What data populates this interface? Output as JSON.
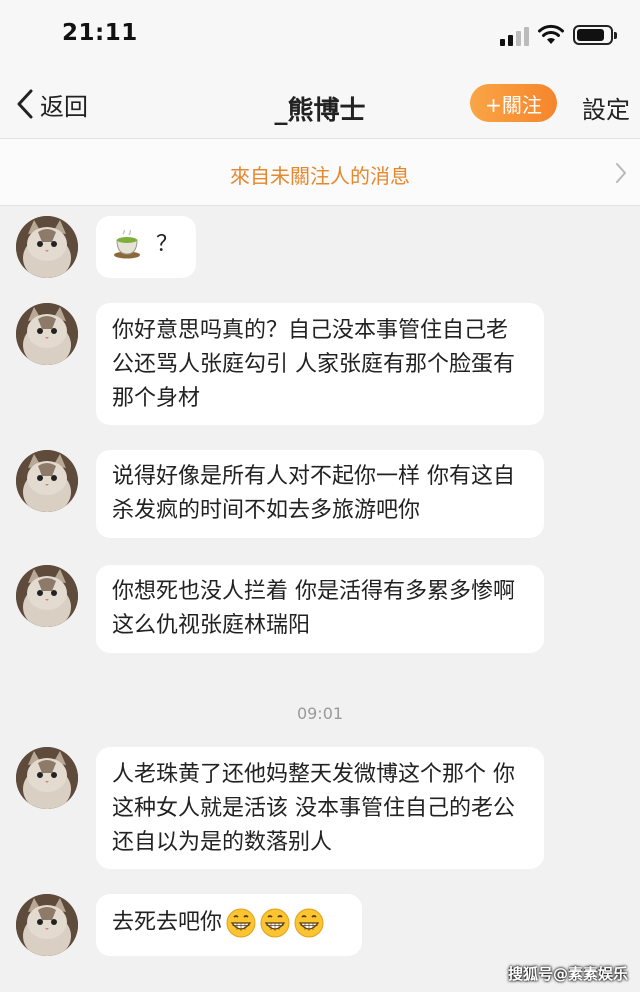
{
  "status_bar": {
    "time": "21:11"
  },
  "nav": {
    "back_label": "返回",
    "title": "_熊博士",
    "follow_label": "+關注",
    "settings_label": "設定"
  },
  "banner": {
    "text": "來自未關注人的消息"
  },
  "messages": [
    {
      "text": "？",
      "icon": "tea-icon"
    },
    {
      "text": "你好意思吗真的？自己没本事管住自己老公还骂人张庭勾引  人家张庭有那个脸蛋有那个身材"
    },
    {
      "text": "说得好像是所有人对不起你一样 你有这自杀发疯的时间不如去多旅游吧你"
    },
    {
      "text": "你想死也没人拦着 你是活得有多累多惨啊 这么仇视张庭林瑞阳"
    },
    {
      "text": "人老珠黄了还他妈整天发微博这个那个 你这种女人就是活该 没本事管住自己的老公还自以为是的数落别人"
    },
    {
      "text": "去死去吧你",
      "icons": [
        "grin-icon",
        "grin-icon",
        "grin-icon"
      ]
    }
  ],
  "time_divider": "09:01",
  "watermark": "搜狐号@素素娱乐",
  "colors": {
    "accent": "#f6852b",
    "banner_text": "#e5872d",
    "background": "#f1f1f1"
  }
}
